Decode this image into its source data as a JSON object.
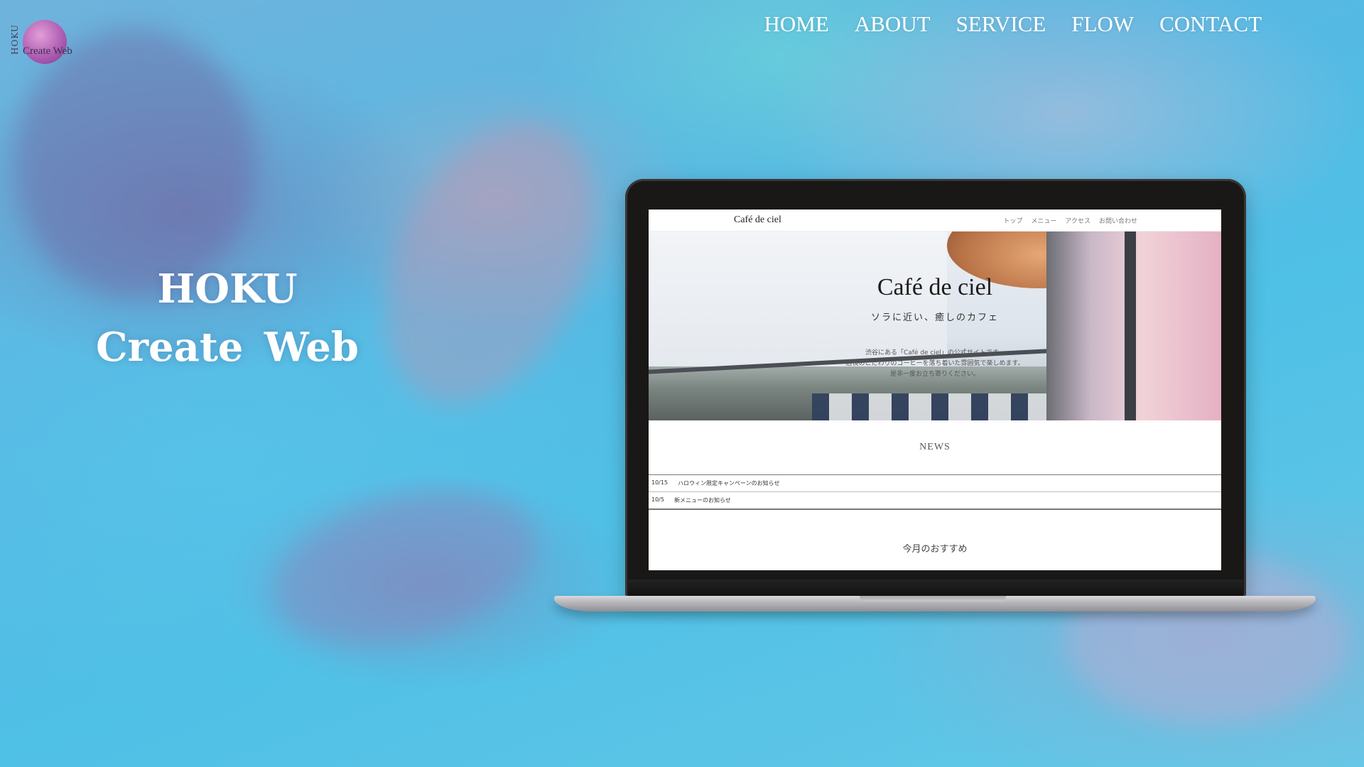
{
  "logo": {
    "vertical_text": "HOKU",
    "text": "Create Web"
  },
  "nav": [
    {
      "label": "HOME"
    },
    {
      "label": "ABOUT"
    },
    {
      "label": "SERVICE"
    },
    {
      "label": "FLOW"
    },
    {
      "label": "CONTACT"
    }
  ],
  "hero": {
    "line1": "HOKU",
    "line2": "Create Web"
  },
  "mockup": {
    "brand": "Café de ciel",
    "nav": [
      "トップ",
      "メニュー",
      "アクセス",
      "お問い合わせ"
    ],
    "title": "Café de ciel",
    "subtitle": "ソラに近い、癒しのカフェ",
    "description": [
      "渋谷にある「Café de ciel」の公式サイトです。",
      "店長のこだわりのコーヒーを落ち着いた雰囲気で楽しめます。",
      "是非一度お立ち寄りください。"
    ],
    "news_title": "NEWS",
    "news": [
      {
        "date": "10/15",
        "text": "ハロウィン限定キャンペーンのお知らせ"
      },
      {
        "date": "10/5",
        "text": "新メニューのお知らせ"
      }
    ],
    "recommend_title": "今月のおすすめ"
  },
  "colors": {
    "background_primary": "#56b8e3",
    "logo_circle": "#b05fb4",
    "laptop_frame": "#1a1717",
    "text_light": "#ffffff"
  }
}
